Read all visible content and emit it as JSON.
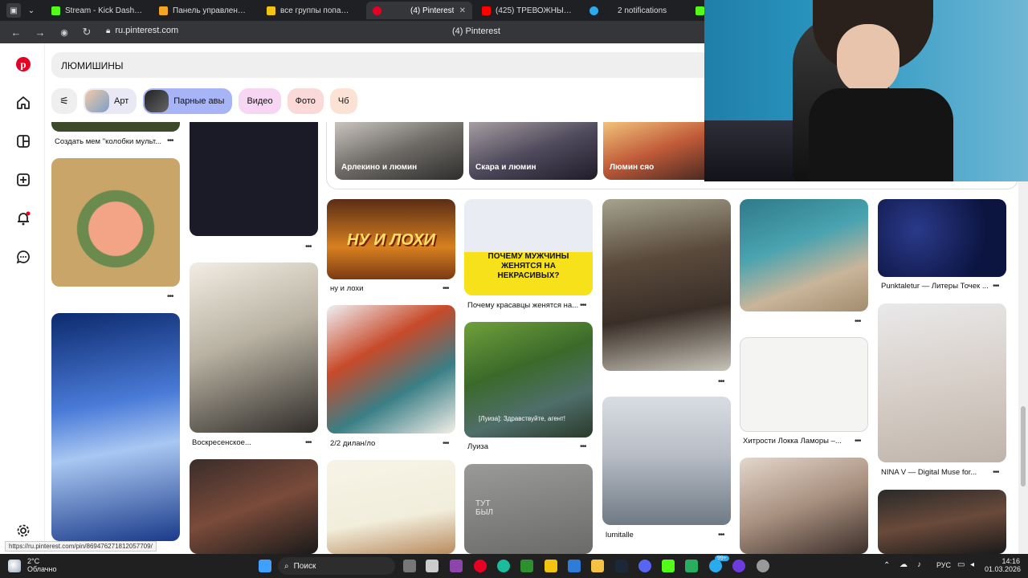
{
  "browser": {
    "tabs": [
      {
        "label": "Stream - Kick Dashboard",
        "color": "#53fc18"
      },
      {
        "label": "Панель управления - Dor",
        "color": "#f5a623"
      },
      {
        "label": "все группы попадан",
        "color": "#f1c40f"
      },
      {
        "label": "(4) Pinterest",
        "color": "#e60023",
        "active": true
      },
      {
        "label": "(425) ТРЕВОЖНЫЕ истор",
        "color": "#ff0000"
      },
      {
        "label": "2 notifications",
        "color": "#2aabee"
      }
    ],
    "url": "ru.pinterest.com",
    "page_title": "(4) Pinterest"
  },
  "pinterest": {
    "search_query": "ЛЮМИШИНЫ",
    "chips": [
      {
        "label": "Арт",
        "bg": "#e9e9f5"
      },
      {
        "label": "Парные авы",
        "bg": "#a7b5f7"
      },
      {
        "label": "Видео",
        "bg": "#f7d6f3"
      },
      {
        "label": "Фото",
        "bg": "#fbd9d9"
      },
      {
        "label": "Чб",
        "bg": "#fbe2d5"
      }
    ],
    "boards": [
      "Арлекино и люмин",
      "Скара и люмин",
      "Люмин сяо"
    ],
    "pins": {
      "meme": "Создать мем \"колобки мульт...",
      "voskresenskoe": "Воскресенское...",
      "nu_i_lohi": "ну и лохи",
      "dilan": "2/2 дилан/ло",
      "pochemu": "Почему красавцы женятся на...",
      "luiza": "Луиза",
      "luiza_sub": "[Луиза]: Здравствуйте, агент!",
      "lumitalle": "lumitalle",
      "punkt": "Punktaletur — Литеры Точек ...",
      "hitrosti": "Хитрости Локка Ламоры –...",
      "nina": "NINA V — Digital Muse for...",
      "lohi_banner": "НУ И ЛОХИ",
      "macron_banner": "ПОЧЕМУ МУЖЧИНЫ ЖЕНЯТСЯ НА НЕКРАСИВЫХ?",
      "tut_byl": "ТУТ БЫЛ"
    },
    "status_url": "https://ru.pinterest.com/pin/869476271812057709/"
  },
  "taskbar": {
    "weather_temp": "2°C",
    "weather_desc": "Облачно",
    "search_label": "Поиск",
    "lang": "РУС",
    "time": "14:16",
    "date": "01.03.2026",
    "badge": "99+"
  }
}
